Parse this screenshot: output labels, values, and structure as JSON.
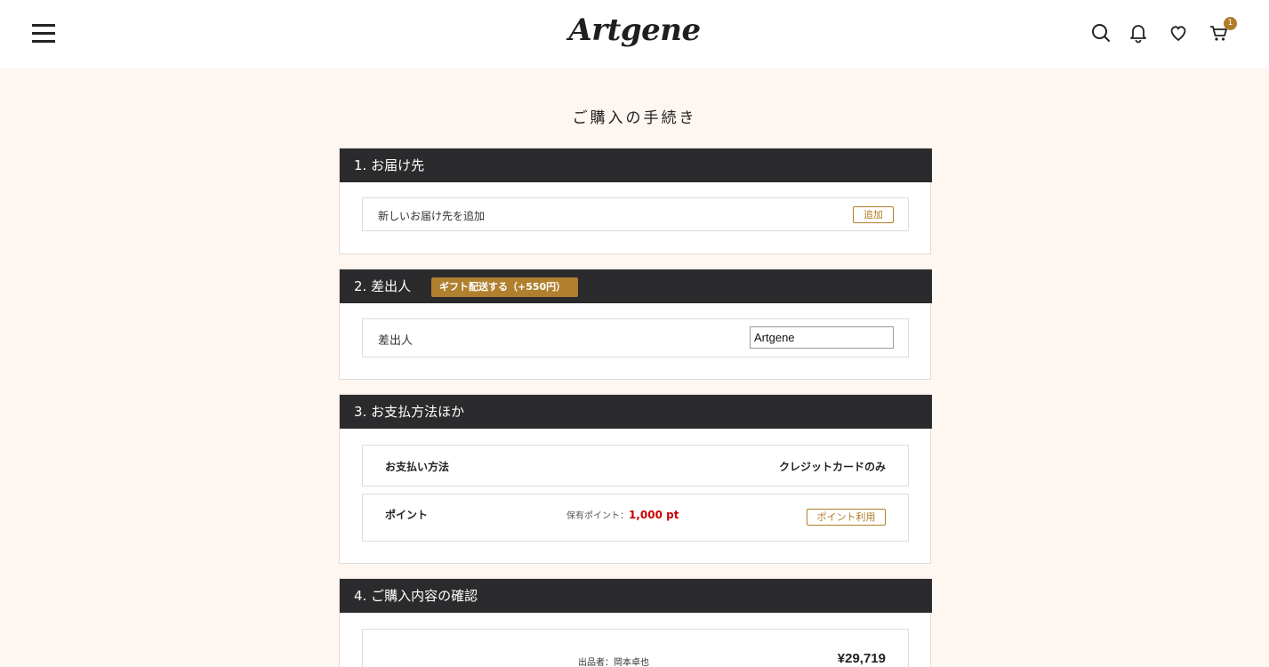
{
  "header": {
    "logo": "Artgene",
    "cart_count": "1",
    "icons": [
      "menu-icon",
      "search-icon",
      "bell-icon",
      "heart-icon",
      "cart-icon"
    ]
  },
  "page": {
    "title": "ご購入の手続き"
  },
  "delivery": {
    "heading": "1. お届け先",
    "add_text": "新しいお届け先を追加",
    "add_button": "追加"
  },
  "sender": {
    "heading": "2. 差出人",
    "gift_button": "ギフト配送する（+550円）",
    "label": "差出人",
    "value": "Artgene"
  },
  "payment": {
    "heading": "3. お支払方法ほか",
    "method_label": "お支払い方法",
    "method_value": "クレジットカードのみ",
    "points_label": "ポイント",
    "points_held_label": "保有ポイント：",
    "points_value": "1,000 pt",
    "points_button": "ポイント利用"
  },
  "confirm": {
    "heading": "4. ご購入内容の確認",
    "seller": "出品者：岡本卓也",
    "price": "¥29,719"
  },
  "colors": {
    "accent": "#b07c2a",
    "header_bar": "#2b2b2d",
    "page_bg": "#fdf6f1",
    "points_red": "#cc0000"
  }
}
